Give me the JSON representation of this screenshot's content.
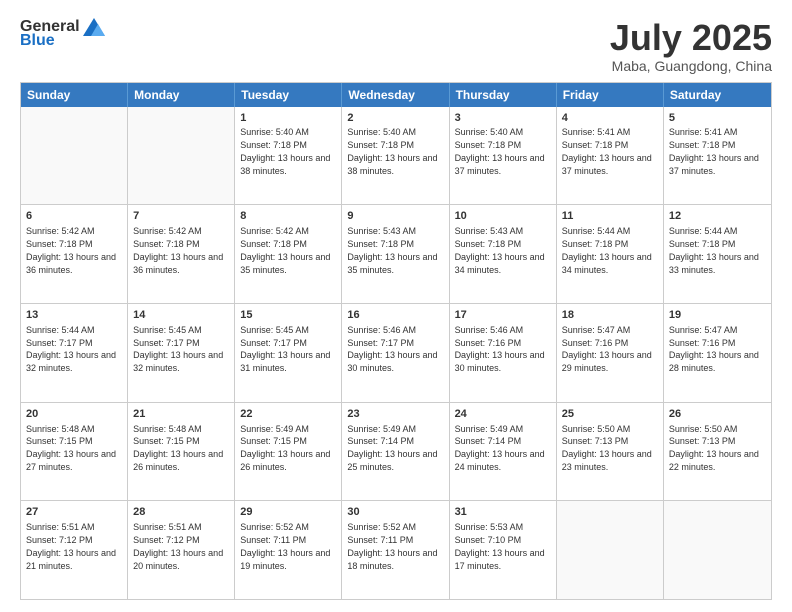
{
  "logo": {
    "line1": "General",
    "line2": "Blue",
    "icon_color": "#1a6fc4"
  },
  "title": "July 2025",
  "location": "Maba, Guangdong, China",
  "days_of_week": [
    "Sunday",
    "Monday",
    "Tuesday",
    "Wednesday",
    "Thursday",
    "Friday",
    "Saturday"
  ],
  "weeks": [
    [
      {
        "day": "",
        "info": ""
      },
      {
        "day": "",
        "info": ""
      },
      {
        "day": "1",
        "info": "Sunrise: 5:40 AM\nSunset: 7:18 PM\nDaylight: 13 hours and 38 minutes."
      },
      {
        "day": "2",
        "info": "Sunrise: 5:40 AM\nSunset: 7:18 PM\nDaylight: 13 hours and 38 minutes."
      },
      {
        "day": "3",
        "info": "Sunrise: 5:40 AM\nSunset: 7:18 PM\nDaylight: 13 hours and 37 minutes."
      },
      {
        "day": "4",
        "info": "Sunrise: 5:41 AM\nSunset: 7:18 PM\nDaylight: 13 hours and 37 minutes."
      },
      {
        "day": "5",
        "info": "Sunrise: 5:41 AM\nSunset: 7:18 PM\nDaylight: 13 hours and 37 minutes."
      }
    ],
    [
      {
        "day": "6",
        "info": "Sunrise: 5:42 AM\nSunset: 7:18 PM\nDaylight: 13 hours and 36 minutes."
      },
      {
        "day": "7",
        "info": "Sunrise: 5:42 AM\nSunset: 7:18 PM\nDaylight: 13 hours and 36 minutes."
      },
      {
        "day": "8",
        "info": "Sunrise: 5:42 AM\nSunset: 7:18 PM\nDaylight: 13 hours and 35 minutes."
      },
      {
        "day": "9",
        "info": "Sunrise: 5:43 AM\nSunset: 7:18 PM\nDaylight: 13 hours and 35 minutes."
      },
      {
        "day": "10",
        "info": "Sunrise: 5:43 AM\nSunset: 7:18 PM\nDaylight: 13 hours and 34 minutes."
      },
      {
        "day": "11",
        "info": "Sunrise: 5:44 AM\nSunset: 7:18 PM\nDaylight: 13 hours and 34 minutes."
      },
      {
        "day": "12",
        "info": "Sunrise: 5:44 AM\nSunset: 7:18 PM\nDaylight: 13 hours and 33 minutes."
      }
    ],
    [
      {
        "day": "13",
        "info": "Sunrise: 5:44 AM\nSunset: 7:17 PM\nDaylight: 13 hours and 32 minutes."
      },
      {
        "day": "14",
        "info": "Sunrise: 5:45 AM\nSunset: 7:17 PM\nDaylight: 13 hours and 32 minutes."
      },
      {
        "day": "15",
        "info": "Sunrise: 5:45 AM\nSunset: 7:17 PM\nDaylight: 13 hours and 31 minutes."
      },
      {
        "day": "16",
        "info": "Sunrise: 5:46 AM\nSunset: 7:17 PM\nDaylight: 13 hours and 30 minutes."
      },
      {
        "day": "17",
        "info": "Sunrise: 5:46 AM\nSunset: 7:16 PM\nDaylight: 13 hours and 30 minutes."
      },
      {
        "day": "18",
        "info": "Sunrise: 5:47 AM\nSunset: 7:16 PM\nDaylight: 13 hours and 29 minutes."
      },
      {
        "day": "19",
        "info": "Sunrise: 5:47 AM\nSunset: 7:16 PM\nDaylight: 13 hours and 28 minutes."
      }
    ],
    [
      {
        "day": "20",
        "info": "Sunrise: 5:48 AM\nSunset: 7:15 PM\nDaylight: 13 hours and 27 minutes."
      },
      {
        "day": "21",
        "info": "Sunrise: 5:48 AM\nSunset: 7:15 PM\nDaylight: 13 hours and 26 minutes."
      },
      {
        "day": "22",
        "info": "Sunrise: 5:49 AM\nSunset: 7:15 PM\nDaylight: 13 hours and 26 minutes."
      },
      {
        "day": "23",
        "info": "Sunrise: 5:49 AM\nSunset: 7:14 PM\nDaylight: 13 hours and 25 minutes."
      },
      {
        "day": "24",
        "info": "Sunrise: 5:49 AM\nSunset: 7:14 PM\nDaylight: 13 hours and 24 minutes."
      },
      {
        "day": "25",
        "info": "Sunrise: 5:50 AM\nSunset: 7:13 PM\nDaylight: 13 hours and 23 minutes."
      },
      {
        "day": "26",
        "info": "Sunrise: 5:50 AM\nSunset: 7:13 PM\nDaylight: 13 hours and 22 minutes."
      }
    ],
    [
      {
        "day": "27",
        "info": "Sunrise: 5:51 AM\nSunset: 7:12 PM\nDaylight: 13 hours and 21 minutes."
      },
      {
        "day": "28",
        "info": "Sunrise: 5:51 AM\nSunset: 7:12 PM\nDaylight: 13 hours and 20 minutes."
      },
      {
        "day": "29",
        "info": "Sunrise: 5:52 AM\nSunset: 7:11 PM\nDaylight: 13 hours and 19 minutes."
      },
      {
        "day": "30",
        "info": "Sunrise: 5:52 AM\nSunset: 7:11 PM\nDaylight: 13 hours and 18 minutes."
      },
      {
        "day": "31",
        "info": "Sunrise: 5:53 AM\nSunset: 7:10 PM\nDaylight: 13 hours and 17 minutes."
      },
      {
        "day": "",
        "info": ""
      },
      {
        "day": "",
        "info": ""
      }
    ]
  ]
}
